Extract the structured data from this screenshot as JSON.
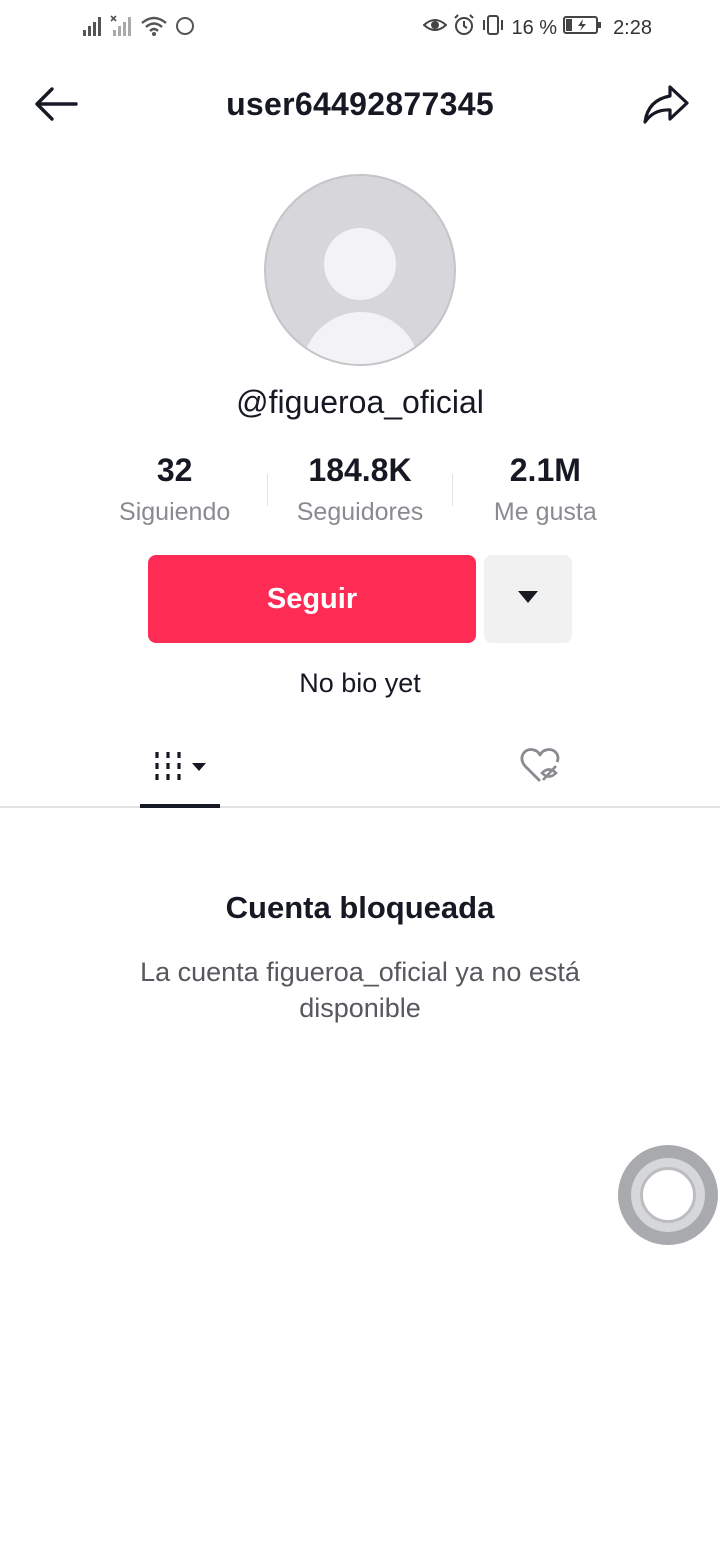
{
  "status_bar": {
    "battery_percent": "16 %",
    "time": "2:28",
    "icons": [
      "signal-icon",
      "signal-no-sim-icon",
      "wifi-icon",
      "circle-icon",
      "eye-icon",
      "alarm-icon",
      "vibrate-icon",
      "battery-charging-icon"
    ]
  },
  "header": {
    "title": "user64492877345",
    "back_icon": "arrow-left-icon",
    "share_icon": "share-arrow-icon"
  },
  "profile": {
    "handle": "@figueroa_oficial",
    "stats": [
      {
        "value": "32",
        "label": "Siguiendo"
      },
      {
        "value": "184.8K",
        "label": "Seguidores"
      },
      {
        "value": "2.1M",
        "label": "Me gusta"
      }
    ],
    "follow_label": "Seguir",
    "bio": "No bio yet"
  },
  "tabs": {
    "videos_icon": "grid-columns-icon",
    "liked_icon": "heart-hidden-icon"
  },
  "blocked": {
    "title": "Cuenta bloqueada",
    "description": "La cuenta figueroa_oficial ya no está disponible"
  },
  "colors": {
    "accent": "#fe2c55",
    "text": "#161823",
    "muted": "#8a8b91"
  }
}
